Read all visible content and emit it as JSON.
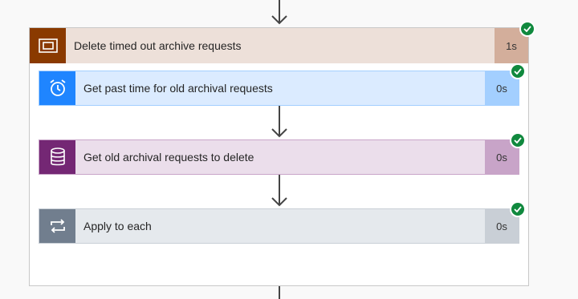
{
  "scope": {
    "title": "Delete timed out archive requests",
    "duration": "1s",
    "icon": "scope-icon",
    "status": "succeeded"
  },
  "actions": [
    {
      "title": "Get past time for old archival requests",
      "duration": "0s",
      "icon": "alarm-clock-icon",
      "status": "succeeded"
    },
    {
      "title": "Get old archival requests to delete",
      "duration": "0s",
      "icon": "database-icon",
      "status": "succeeded"
    },
    {
      "title": "Apply to each",
      "duration": "0s",
      "icon": "loop-icon",
      "status": "succeeded"
    }
  ],
  "colors": {
    "scope_accent": "#8a3a00",
    "scope_header_bg": "#ede0d9",
    "scope_duration_bg": "#d3ae9b",
    "clock_accent": "#1f85ff",
    "clock_bg": "#dbebff",
    "clock_duration_bg": "#a3cfff",
    "db_accent": "#742774",
    "db_bg": "#ebdeeb",
    "db_duration_bg": "#c8a4c8",
    "loop_accent": "#717e8e",
    "loop_bg": "#e5e9ed",
    "loop_duration_bg": "#c9cfd6",
    "success": "#10893e"
  }
}
